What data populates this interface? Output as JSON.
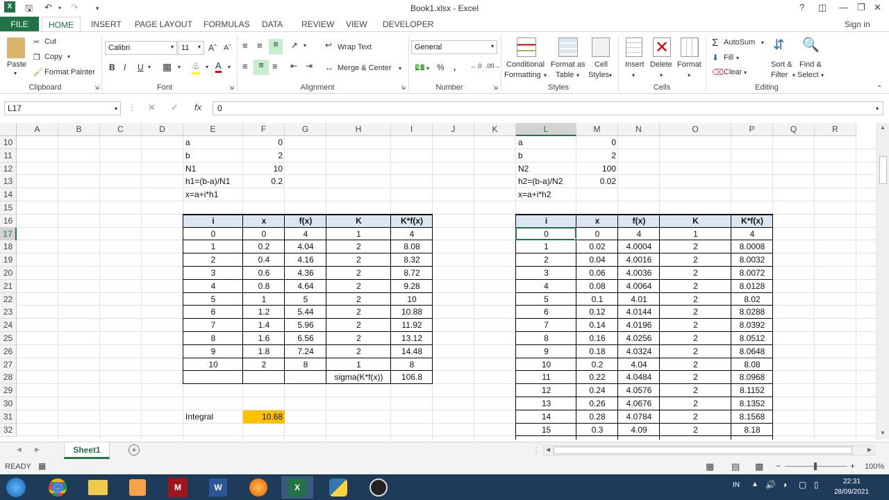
{
  "titlebar": {
    "title": "Book1.xlsx - Excel",
    "help": "?",
    "signin": "Sign in"
  },
  "tabs": [
    "FILE",
    "HOME",
    "INSERT",
    "PAGE LAYOUT",
    "FORMULAS",
    "DATA",
    "REVIEW",
    "VIEW",
    "DEVELOPER"
  ],
  "ribbon": {
    "clipboard": {
      "paste": "Paste",
      "cut": "Cut",
      "copy": "Copy",
      "format_painter": "Format Painter",
      "label": "Clipboard"
    },
    "font": {
      "name": "Calibri",
      "size": "11",
      "bold": "B",
      "italic": "I",
      "underline": "U",
      "label": "Font"
    },
    "alignment": {
      "wrap": "Wrap Text",
      "merge": "Merge & Center",
      "label": "Alignment"
    },
    "number": {
      "format": "General",
      "label": "Number"
    },
    "styles": {
      "conditional": "Conditional",
      "conditional2": "Formatting",
      "format_as": "Format as",
      "format_as2": "Table",
      "cell": "Cell",
      "cell2": "Styles",
      "label": "Styles"
    },
    "cells": {
      "insert": "Insert",
      "delete": "Delete",
      "format": "Format",
      "label": "Cells"
    },
    "editing": {
      "autosum": "AutoSum",
      "fill": "Fill",
      "clear": "Clear",
      "sort": "Sort &",
      "sort2": "Filter",
      "find": "Find &",
      "find2": "Select",
      "label": "Editing"
    }
  },
  "formula_bar": {
    "name_box": "L17",
    "content": "0"
  },
  "columns": [
    "A",
    "B",
    "C",
    "D",
    "E",
    "F",
    "G",
    "H",
    "I",
    "J",
    "K",
    "L",
    "M",
    "N",
    "O",
    "P",
    "Q",
    "R"
  ],
  "rows": [
    "10",
    "11",
    "12",
    "13",
    "14",
    "15",
    "16",
    "17",
    "18",
    "19",
    "20",
    "21",
    "22",
    "23",
    "24",
    "25",
    "26",
    "27",
    "28",
    "29",
    "30",
    "31",
    "32"
  ],
  "left_params": [
    [
      "a",
      "0"
    ],
    [
      "b",
      "2"
    ],
    [
      "N1",
      "10"
    ],
    [
      "h1=(b-a)/N1",
      "0.2"
    ],
    [
      "x=a+i*h1",
      ""
    ]
  ],
  "right_params": [
    [
      "a",
      "0"
    ],
    [
      "b",
      "2"
    ],
    [
      "N2",
      "100"
    ],
    [
      "h2=(b-a)/N2",
      "0.02"
    ],
    [
      "x=a+i*h2",
      ""
    ]
  ],
  "table_headers": [
    "i",
    "x",
    "f(x)",
    "K",
    "K*f(x)"
  ],
  "left_table": [
    [
      "0",
      "0",
      "4",
      "1",
      "4"
    ],
    [
      "1",
      "0.2",
      "4.04",
      "2",
      "8.08"
    ],
    [
      "2",
      "0.4",
      "4.16",
      "2",
      "8.32"
    ],
    [
      "3",
      "0.6",
      "4.36",
      "2",
      "8.72"
    ],
    [
      "4",
      "0.8",
      "4.64",
      "2",
      "9.28"
    ],
    [
      "5",
      "1",
      "5",
      "2",
      "10"
    ],
    [
      "6",
      "1.2",
      "5.44",
      "2",
      "10.88"
    ],
    [
      "7",
      "1.4",
      "5.96",
      "2",
      "11.92"
    ],
    [
      "8",
      "1.6",
      "6.56",
      "2",
      "13.12"
    ],
    [
      "9",
      "1.8",
      "7.24",
      "2",
      "14.48"
    ],
    [
      "10",
      "2",
      "8",
      "1",
      "8"
    ]
  ],
  "left_sum": {
    "label": "sigma(K*f(x))",
    "value": "106.8"
  },
  "integral": {
    "label": "Integral",
    "value": "10.68"
  },
  "right_table": [
    [
      "0",
      "0",
      "4",
      "1",
      "4"
    ],
    [
      "1",
      "0.02",
      "4.0004",
      "2",
      "8.0008"
    ],
    [
      "2",
      "0.04",
      "4.0016",
      "2",
      "8.0032"
    ],
    [
      "3",
      "0.06",
      "4.0036",
      "2",
      "8.0072"
    ],
    [
      "4",
      "0.08",
      "4.0064",
      "2",
      "8.0128"
    ],
    [
      "5",
      "0.1",
      "4.01",
      "2",
      "8.02"
    ],
    [
      "6",
      "0.12",
      "4.0144",
      "2",
      "8.0288"
    ],
    [
      "7",
      "0.14",
      "4.0196",
      "2",
      "8.0392"
    ],
    [
      "8",
      "0.16",
      "4.0256",
      "2",
      "8.0512"
    ],
    [
      "9",
      "0.18",
      "4.0324",
      "2",
      "8.0648"
    ],
    [
      "10",
      "0.2",
      "4.04",
      "2",
      "8.08"
    ],
    [
      "11",
      "0.22",
      "4.0484",
      "2",
      "8.0968"
    ],
    [
      "12",
      "0.24",
      "4.0576",
      "2",
      "8.1152"
    ],
    [
      "13",
      "0.26",
      "4.0676",
      "2",
      "8.1352"
    ],
    [
      "14",
      "0.28",
      "4.0784",
      "2",
      "8.1568"
    ],
    [
      "15",
      "0.3",
      "4.09",
      "2",
      "8.18"
    ]
  ],
  "sheet_tab": "Sheet1",
  "status": {
    "ready": "READY",
    "zoom": "100%"
  },
  "taskbar": {
    "lang": "IN",
    "time": "22:31",
    "date": "28/09/2021"
  },
  "colors": {
    "excel_green": "#217346",
    "header_fill": "#dce6f1",
    "integral_fill": "#ffc000"
  }
}
